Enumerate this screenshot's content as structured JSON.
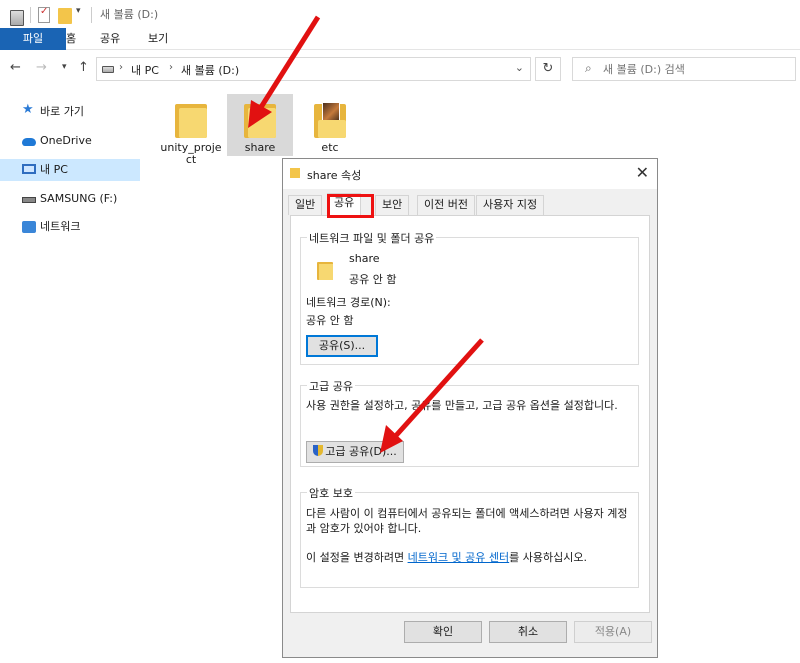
{
  "window": {
    "title": "새 볼륨 (D:)"
  },
  "ribbon": {
    "tabs": [
      "파일",
      "홈",
      "공유",
      "보기"
    ]
  },
  "address": {
    "segments": [
      "내 PC",
      "새 볼륨 (D:)"
    ],
    "refresh_icon": "refresh-icon"
  },
  "search": {
    "placeholder": "새 볼륨 (D:) 검색"
  },
  "sidebar": {
    "items": [
      {
        "label": "바로 가기",
        "icon": "star-icon"
      },
      {
        "label": "OneDrive",
        "icon": "cloud-icon"
      },
      {
        "label": "내 PC",
        "icon": "computer-icon",
        "selected": true
      },
      {
        "label": "SAMSUNG (F:)",
        "icon": "usb-drive-icon"
      },
      {
        "label": "네트워크",
        "icon": "network-icon"
      }
    ]
  },
  "files": [
    {
      "name": "unity_project"
    },
    {
      "name": "share",
      "selected": true
    },
    {
      "name": "etc"
    }
  ],
  "dialog": {
    "title": "share 속성",
    "tabs": [
      "일반",
      "공유",
      "보안",
      "이전 버전",
      "사용자 지정"
    ],
    "active_tab": "공유",
    "network_share": {
      "title": "네트워크 파일 및 폴더 공유",
      "folder_name": "share",
      "folder_status": "공유 안 함",
      "path_label": "네트워크 경로(N):",
      "path_value": "공유 안 함",
      "share_button": "공유(S)..."
    },
    "advanced_share": {
      "title": "고급 공유",
      "description": "사용 권한을 설정하고, 공유를 만들고, 고급 공유 옵션을 설정합니다.",
      "button": "고급 공유(D)..."
    },
    "password": {
      "title": "암호 보호",
      "description": "다른 사람이 이 컴퓨터에서 공유되는 폴더에 액세스하려면 사용자 계정과 암호가 있어야 합니다.",
      "change_prefix": "이 설정을 변경하려면",
      "link": "네트워크 및 공유 센터",
      "change_suffix": "를 사용하십시오."
    },
    "buttons": {
      "ok": "확인",
      "cancel": "취소",
      "apply": "적용(A)"
    }
  },
  "colors": {
    "accent": "#1a64b4",
    "annotation": "#e11111",
    "selection": "#cce8ff"
  }
}
